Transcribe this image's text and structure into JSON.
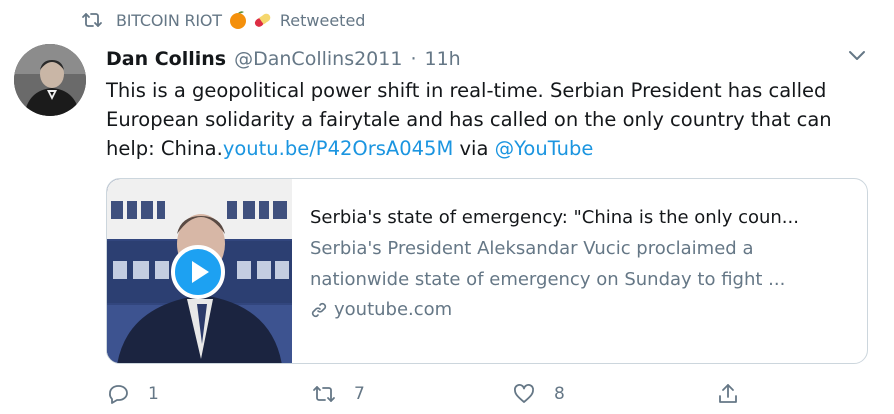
{
  "retweet_context": {
    "retweeter_name": "BITCOIN RIOT",
    "emojis": [
      "orange-emoji",
      "pill-emoji"
    ],
    "label": "Retweeted"
  },
  "tweet": {
    "author_name": "Dan Collins",
    "author_handle": "@DanCollins2011",
    "separator": "·",
    "timestamp": "11h",
    "text_before_link": "This is a geopolitical power shift in real-time. Serbian President has called European solidarity a fairytale and has called on the only country that can help: China.",
    "link_url": "youtu.be/P42OrsA045M",
    "via_text": " via ",
    "via_mention": "@YouTube"
  },
  "card": {
    "title": "Serbia's state of emergency: \"China is the only coun...",
    "description": "Serbia's President Aleksandar Vucic proclaimed a nationwide state of emergency on Sunday to fight ...",
    "domain": "youtube.com",
    "thumbnail_icon": "play-button-icon"
  },
  "actions": {
    "reply_count": "1",
    "retweet_count": "7",
    "like_count": "8"
  },
  "colors": {
    "link": "#1b95e0",
    "muted": "#657786",
    "text": "#14171a",
    "border": "#ccd6dd"
  }
}
